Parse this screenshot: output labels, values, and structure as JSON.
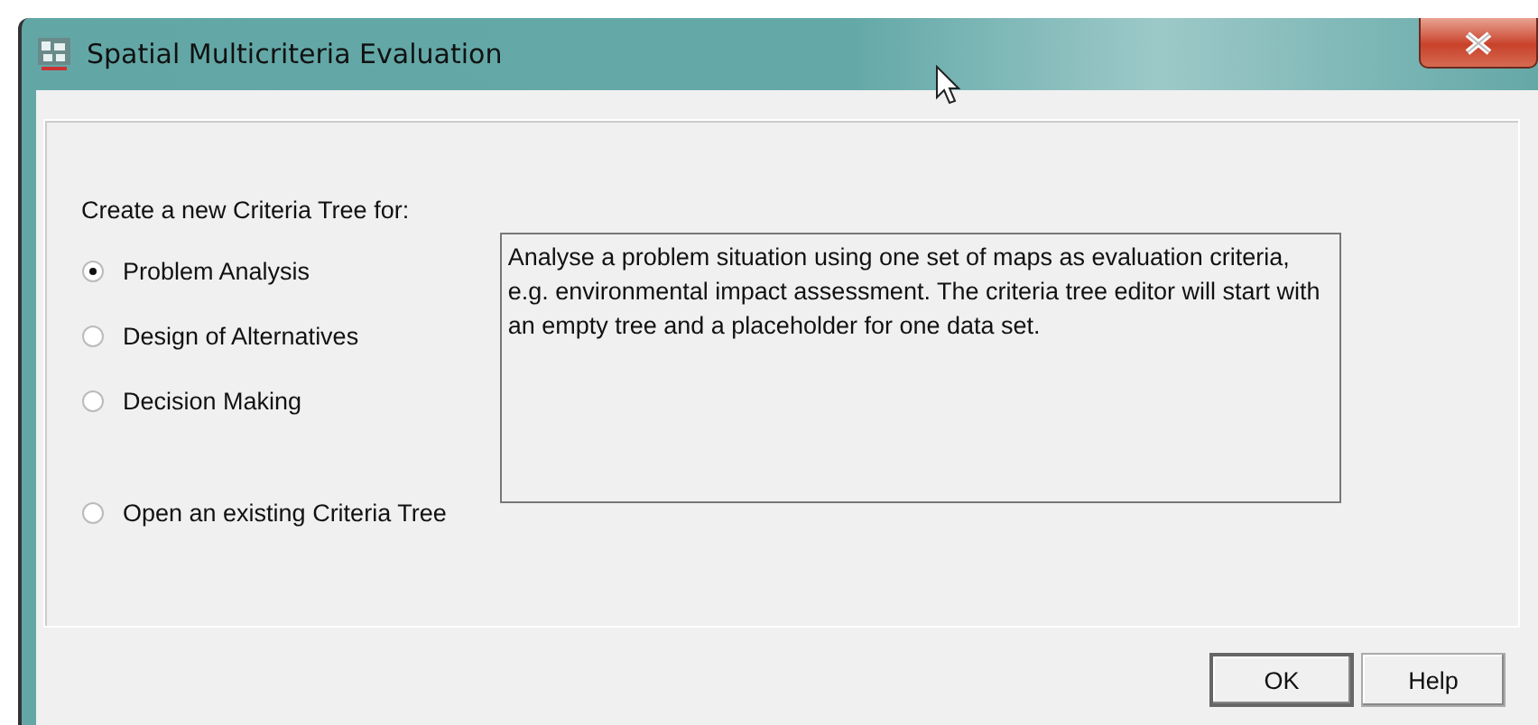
{
  "window": {
    "title": "Spatial Multicriteria Evaluation"
  },
  "prompt": "Create a new Criteria Tree for:",
  "options": [
    {
      "label": "Problem Analysis",
      "selected": true
    },
    {
      "label": "Design of Alternatives",
      "selected": false
    },
    {
      "label": "Decision Making",
      "selected": false
    },
    {
      "label": "Open an existing Criteria Tree",
      "selected": false
    }
  ],
  "description": "Analyse a problem situation using one set of maps as evaluation criteria, e.g. environmental impact assessment. The criteria tree editor will start with an empty tree and a placeholder for one data set.",
  "buttons": [
    {
      "label": "OK",
      "default": true
    },
    {
      "label": "Help",
      "default": false
    }
  ]
}
